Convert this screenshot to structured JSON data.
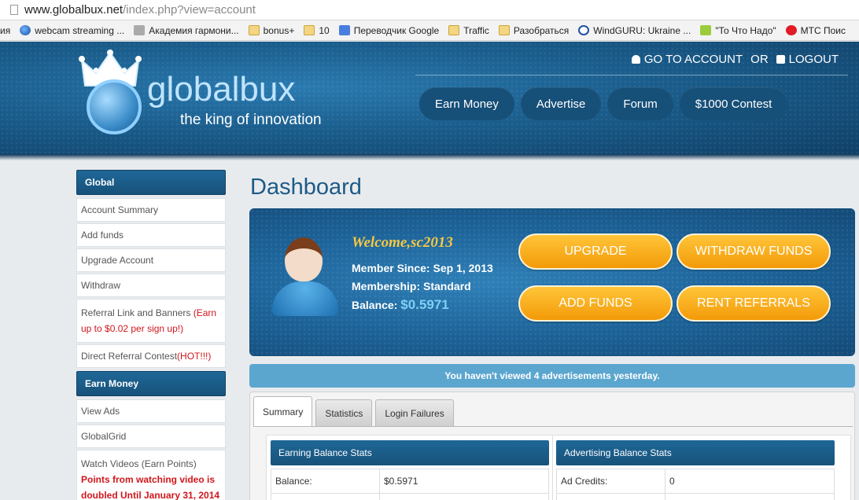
{
  "browser": {
    "url_host": "www.globalbux.net",
    "url_path": "/index.php?view=account"
  },
  "bookmarks": [
    {
      "label": "ия",
      "icon": "none"
    },
    {
      "label": "webcam streaming ...",
      "icon": "globe-icon"
    },
    {
      "label": "Академия гармони...",
      "icon": "academy-icon"
    },
    {
      "label": "bonus+",
      "icon": "folder-icon"
    },
    {
      "label": "10",
      "icon": "folder-icon"
    },
    {
      "label": "Переводчик Google",
      "icon": "google-translate-icon"
    },
    {
      "label": "Traffic",
      "icon": "folder-icon"
    },
    {
      "label": "Разобраться",
      "icon": "folder-icon"
    },
    {
      "label": "WindGURU: Ukraine ...",
      "icon": "windguru-icon"
    },
    {
      "label": "\"То Что Надо\"",
      "icon": "t-icon"
    },
    {
      "label": "МТС Поис",
      "icon": "mts-icon"
    }
  ],
  "header": {
    "brand": "globalbux",
    "tagline": "the king of innovation",
    "go_to_account": "GO TO ACCOUNT",
    "or": "OR",
    "logout": "LOGOUT",
    "nav": [
      "Earn Money",
      "Advertise",
      "Forum",
      "$1000 Contest"
    ]
  },
  "sidebar": {
    "global_title": "Global",
    "global_items": [
      "Account Summary",
      "Add funds",
      "Upgrade Account",
      "Withdraw"
    ],
    "referral_text": "Referral Link and Banners ",
    "referral_note": "(Earn up to $0.02 per sign up!)",
    "contest_text": "Direct Referral Contest ",
    "contest_note": "(HOT!!!)",
    "earn_title": "Earn Money",
    "earn_items": [
      "View Ads",
      "GlobalGrid"
    ],
    "videos_text": "Watch Videos (Earn Points)",
    "videos_note": "Points from watching video is doubled Until January 31, 2014"
  },
  "main": {
    "title": "Dashboard",
    "welcome": "Welcome,sc2013",
    "member_since_label": "Member Since: ",
    "member_since": "Sep 1, 2013",
    "membership_label": "Membership: ",
    "membership": "Standard",
    "balance_label": "Balance: ",
    "balance": "$0.5971",
    "buttons": {
      "upgrade": "UPGRADE",
      "withdraw": "WITHDRAW FUNDS",
      "add_funds": "ADD FUNDS",
      "rent_referrals": "RENT REFERRALS"
    },
    "notice": "You haven't viewed 4 advertisements yesterday.",
    "tabs": [
      "Summary",
      "Statistics",
      "Login Failures"
    ],
    "earning_title": "Earning Balance Stats",
    "earning_balance_label": "Balance:",
    "earning_balance_value": "$0.5971",
    "advertising_title": "Advertising Balance Stats",
    "ad_credits_label": "Ad Credits:",
    "ad_credits_value": "0"
  },
  "colors": {
    "header_blue": "#1a5d8c",
    "orange_button": "#f39a08",
    "welcome_gold": "#f5c842",
    "notice_blue": "#5ba6cf"
  }
}
